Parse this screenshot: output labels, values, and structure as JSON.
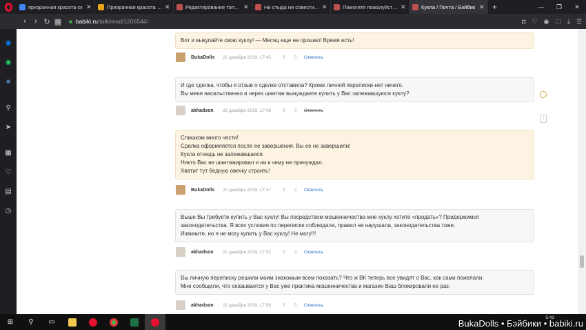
{
  "browser": {
    "tabs": [
      {
        "title": "призрачная красота ск",
        "favicon_color": "#4285f4",
        "active": false
      },
      {
        "title": "Призрачная красота / С",
        "favicon_color": "#e8a317",
        "active": false
      },
      {
        "title": "Редактирование топика",
        "favicon_color": "#c0504d",
        "active": false
      },
      {
        "title": "Ни стыда ни совести / Б",
        "favicon_color": "#c0504d",
        "active": false
      },
      {
        "title": "Помогите пожалуйста с",
        "favicon_color": "#c0504d",
        "active": false
      },
      {
        "title": "Кукла / Почта / Бэйбик",
        "favicon_color": "#c0504d",
        "active": true
      }
    ],
    "new_tab_label": "+",
    "url_host": "babiki.ru",
    "url_path": "/talk/read/1206544/"
  },
  "comments": [
    {
      "role": "seller",
      "lines": [
        "Вот и выкупайте свою куклу! — Месяц еще не прошел! Время есть!"
      ],
      "author": "BukaDolls",
      "date": "22 декабря 2019, 17:45",
      "reply": "Ответить",
      "reply_struck": false
    },
    {
      "role": "buyer",
      "lines": [
        "И где сделка, чтобы я отзыв о сделке отставила? Кроме личной переписки-нет ничего.",
        "Вы меня насильственно и через шантаж вынуждаете купить у Вас залежавшуюся куклу?"
      ],
      "author": "akhadson",
      "date": "22 декабря 2019, 17:46",
      "reply": "Ответить",
      "reply_struck": true
    },
    {
      "role": "seller",
      "lines": [
        "Слишком много чести!",
        "Сделка оформляется после ее завершения. Вы ее не завершили!",
        "Кукла отнюдь не залежавшаяся.",
        "Никто Вас не шантажировал и ни к чему не принуждал.",
        "Хватит тут бедную овечку строить!"
      ],
      "author": "BukaDolls",
      "date": "22 декабря 2019, 17:47",
      "reply": "Ответить",
      "reply_struck": false
    },
    {
      "role": "buyer",
      "lines": [
        "Выше Вы требуете купить у Вас куклу! Вы посредством мошенничества мне куклу хотите «продать»? Придержимся",
        "законодательства. Я всех условия по переписке соблюдала, правил не нарушала, законодательства тоже.",
        "Извините, но я не могу купить у Вас куклу! Не могу!!!"
      ],
      "author": "akhadson",
      "date": "22 декабря 2019, 17:52",
      "reply": "Ответить",
      "reply_struck": false
    },
    {
      "role": "buyer",
      "lines": [
        "Вы личную переписку решили моим знакомым всем показать? Что ж ВК теперь все увидят о Вас, как сами пожелали.",
        "Мне сообщили, что оказывается у Вас уже практика мошенничества и магазин Ваш блокировали не раз."
      ],
      "author": "akhadson",
      "date": "22 декабря 2019, 17:56",
      "reply": "Ответить",
      "reply_struck": false
    }
  ],
  "vote_up": "⇧",
  "vote_down": "⇩",
  "taskbar": {
    "time": "5:43",
    "watermark": "BukaDolls • Бэйбики • babiki.ru"
  }
}
